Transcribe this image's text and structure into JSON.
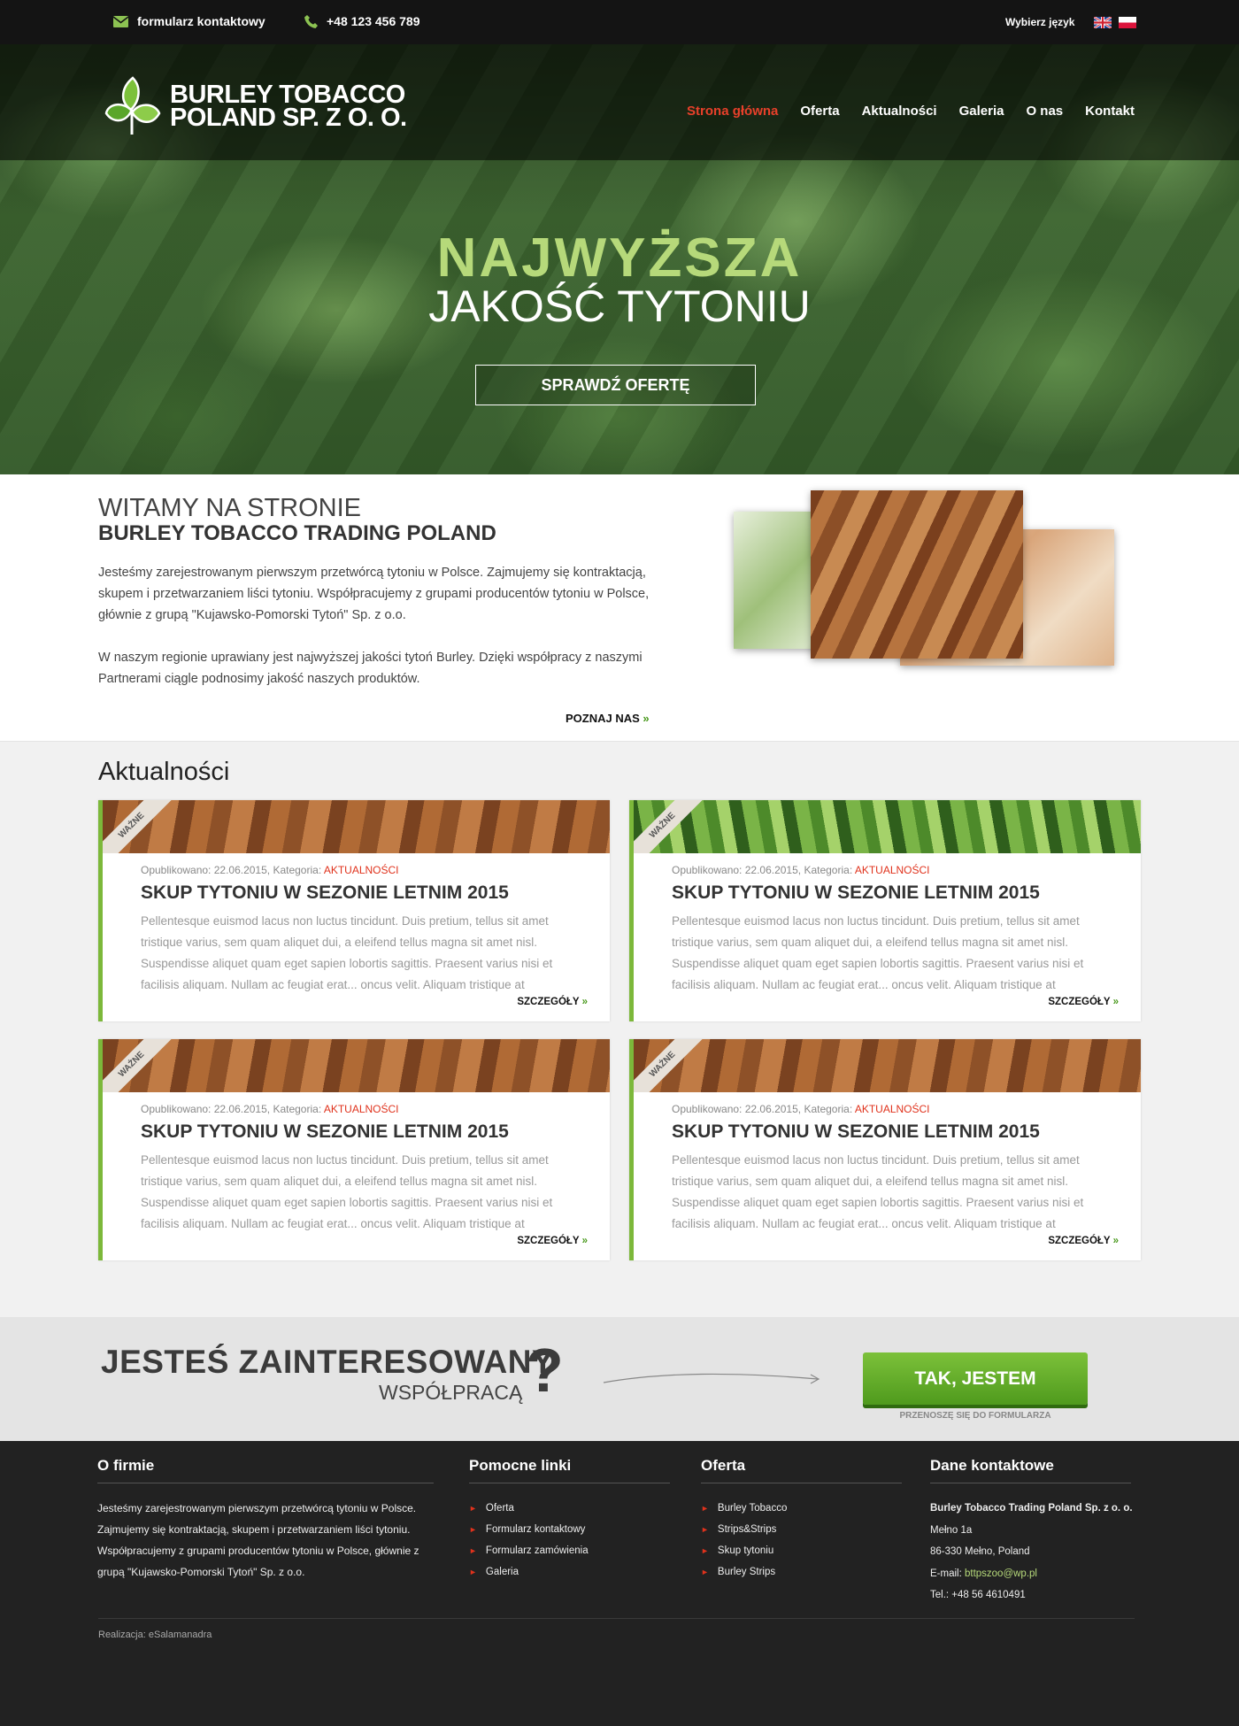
{
  "topbar": {
    "contact_form": "formularz kontaktowy",
    "phone": "+48 123 456 789",
    "language_label": "Wybierz język"
  },
  "header": {
    "logo_line1": "BURLEY TOBACCO",
    "logo_line2": "POLAND SP. Z O. O.",
    "nav": [
      "Strona główna",
      "Oferta",
      "Aktualności",
      "Galeria",
      "O nas",
      "Kontakt"
    ]
  },
  "hero": {
    "title": "NAJWYŻSZA",
    "subtitle": "JAKOŚĆ TYTONIU",
    "button": "SPRAWDŹ OFERTĘ"
  },
  "welcome": {
    "title1": "WITAMY NA STRONIE",
    "title2": "BURLEY TOBACCO TRADING POLAND",
    "p1": "Jesteśmy zarejestrowanym pierwszym przetwórcą tytoniu w Polsce. Zajmujemy się kontraktacją, skupem i przetwarzaniem liści tytoniu. Współpracujemy z grupami producentów tytoniu w Polsce, głównie z grupą \"Kujawsko-Pomorski Tytoń\" Sp. z o.o.",
    "p2": "W naszym regionie uprawiany jest najwyższej jakości tytoń Burley. Dzięki współpracy z naszymi Partnerami ciągle podnosimy jakość naszych produktów.",
    "more": "POZNAJ NAS"
  },
  "news": {
    "title": "Aktualności",
    "items": [
      {
        "badge": "WAŻNE",
        "meta": "Opublikowano: 22.06.2015, Kategoria: ",
        "category": "AKTUALNOŚCI",
        "title": "SKUP TYTONIU W SEZONIE LETNIM 2015",
        "text": "Pellentesque euismod lacus non luctus tincidunt. Duis pretium, tellus sit amet tristique varius, sem quam aliquet dui, a eleifend tellus magna sit amet nisl. Suspendisse aliquet quam eget sapien lobortis sagittis. Praesent varius nisi et facilisis aliquam. Nullam ac feugiat erat...     oncus velit. Aliquam tristique at",
        "more": "SZCZEGÓŁY"
      },
      {
        "badge": "WAŻNE",
        "meta": "Opublikowano: 22.06.2015, Kategoria: ",
        "category": "AKTUALNOŚCI",
        "title": "SKUP TYTONIU W SEZONIE LETNIM 2015",
        "text": "Pellentesque euismod lacus non luctus tincidunt. Duis pretium, tellus sit amet tristique varius, sem quam aliquet dui, a eleifend tellus magna sit amet nisl. Suspendisse aliquet quam eget sapien lobortis sagittis. Praesent varius nisi et facilisis aliquam. Nullam ac feugiat erat...     oncus velit. Aliquam tristique at",
        "more": "SZCZEGÓŁY"
      },
      {
        "badge": "WAŻNE",
        "meta": "Opublikowano: 22.06.2015, Kategoria: ",
        "category": "AKTUALNOŚCI",
        "title": "SKUP TYTONIU W SEZONIE LETNIM 2015",
        "text": "Pellentesque euismod lacus non luctus tincidunt. Duis pretium, tellus sit amet tristique varius, sem quam aliquet dui, a eleifend tellus magna sit amet nisl. Suspendisse aliquet quam eget sapien lobortis sagittis. Praesent varius nisi et facilisis aliquam. Nullam ac feugiat erat...     oncus velit. Aliquam tristique at",
        "more": "SZCZEGÓŁY"
      },
      {
        "badge": "WAŻNE",
        "meta": "Opublikowano: 22.06.2015, Kategoria: ",
        "category": "AKTUALNOŚCI",
        "title": "SKUP TYTONIU W SEZONIE LETNIM 2015",
        "text": "Pellentesque euismod lacus non luctus tincidunt. Duis pretium, tellus sit amet tristique varius, sem quam aliquet dui, a eleifend tellus magna sit amet nisl. Suspendisse aliquet quam eget sapien lobortis sagittis. Praesent varius nisi et facilisis aliquam. Nullam ac feugiat erat...     oncus velit. Aliquam tristique at",
        "more": "SZCZEGÓŁY"
      }
    ]
  },
  "cta": {
    "line1": "JESTEŚ ZAINTERESOWANY",
    "line2": "WSPÓŁPRACĄ",
    "qmark": "?",
    "button": "TAK, JESTEM",
    "sub": "PRZENOSZĘ SIĘ DO FORMULARZA"
  },
  "footer": {
    "about_title": "O firmie",
    "about_text": "Jesteśmy zarejestrowanym pierwszym przetwórcą tytoniu w Polsce. Zajmujemy się kontraktacją, skupem i przetwarzaniem liści tytoniu. Współpracujemy z grupami producentów tytoniu w Polsce, głównie z grupą \"Kujawsko-Pomorski Tytoń\" Sp. z o.o.",
    "links_title": "Pomocne linki",
    "links": [
      "Oferta",
      "Formularz kontaktowy",
      "Formularz zamówienia",
      "Galeria"
    ],
    "offer_title": "Oferta",
    "offer": [
      "Burley Tobacco",
      "Strips&Strips",
      "Skup tytoniu",
      "Burley Strips"
    ],
    "contact_title": "Dane kontaktowe",
    "company": "Burley Tobacco Trading Poland Sp. z o. o.",
    "street": "Mełno 1a",
    "city": "86-330 Mełno, Poland",
    "email_label": "E-mail: ",
    "email": "bttpszoo@wp.pl",
    "tel": "Tel.: +48 56 4610491",
    "credit": "Realizacja: eSalamanadra"
  },
  "colors": {
    "accent_green": "#7cb83a",
    "active_nav": "#e8402a",
    "hero_title": "#b6d97a"
  }
}
